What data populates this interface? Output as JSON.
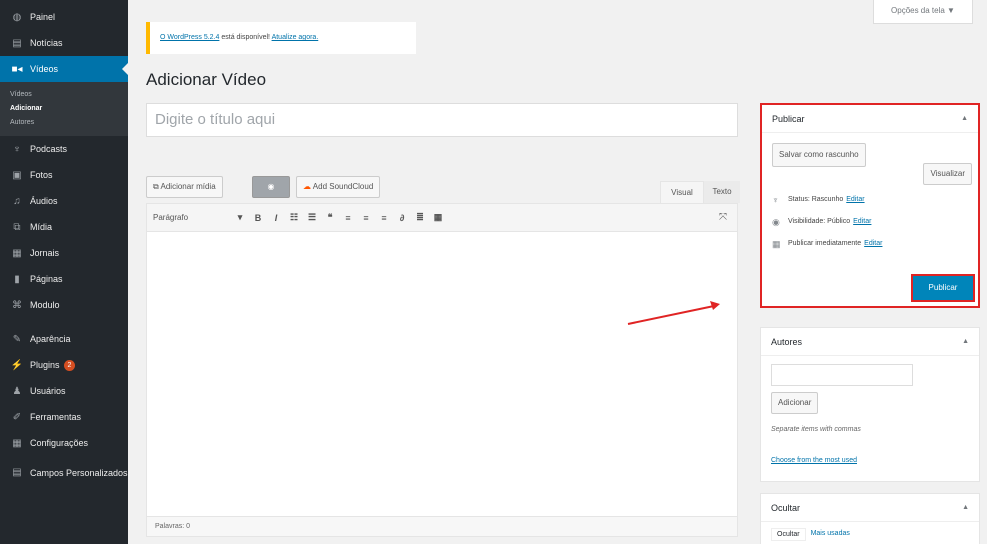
{
  "sidebar": {
    "items": [
      {
        "label": "Painel",
        "icon": "dashboard-icon",
        "glyph": "◍"
      },
      {
        "label": "Notícias",
        "icon": "posts-icon",
        "glyph": "▤"
      },
      {
        "label": "Vídeos",
        "icon": "video-icon",
        "glyph": "■◂",
        "active": true
      },
      {
        "label": "Podcasts",
        "icon": "microphone-icon",
        "glyph": "♆"
      },
      {
        "label": "Fotos",
        "icon": "image-icon",
        "glyph": "▣"
      },
      {
        "label": "Áudios",
        "icon": "music-icon",
        "glyph": "♫"
      },
      {
        "label": "Mídia",
        "icon": "media-icon",
        "glyph": "⧉"
      },
      {
        "label": "Jornais",
        "icon": "newspaper-icon",
        "glyph": "▦"
      },
      {
        "label": "Páginas",
        "icon": "pages-icon",
        "glyph": "▮"
      },
      {
        "label": "Modulo",
        "icon": "module-icon",
        "glyph": "⌘"
      },
      {
        "label": "Aparência",
        "icon": "appearance-icon",
        "glyph": "✎"
      },
      {
        "label": "Plugins",
        "icon": "plugins-icon",
        "glyph": "⚡",
        "badge": "2"
      },
      {
        "label": "Usuários",
        "icon": "users-icon",
        "glyph": "♟"
      },
      {
        "label": "Ferramentas",
        "icon": "tools-icon",
        "glyph": "✐"
      },
      {
        "label": "Configurações",
        "icon": "settings-icon",
        "glyph": "▦"
      },
      {
        "label": "Campos Personalizados",
        "icon": "custom-fields-icon",
        "glyph": "▤"
      }
    ],
    "submenu": [
      "Vídeos",
      "Adicionar",
      "Autores"
    ]
  },
  "screen_options": "Opções da tela ▼",
  "notice": {
    "link_version": "O WordPress 5.2.4",
    "text": " está disponível! ",
    "link_update": "Atualize agora."
  },
  "page_title": "Adicionar Vídeo",
  "title_placeholder": "Digite o título aqui",
  "media_buttons": {
    "add_media": "Adicionar mídia",
    "soundcloud": "Add SoundCloud"
  },
  "editor_tabs": {
    "visual": "Visual",
    "text": "Texto"
  },
  "toolbar": {
    "format": "Parágrafo",
    "buttons": [
      "▾",
      "B",
      "I",
      "☷",
      "☰",
      "❝",
      "≡",
      "≡",
      "≡",
      "∂",
      "≣",
      "▦"
    ],
    "expand": "⤧"
  },
  "editor_footer": "Palavras: 0",
  "publish": {
    "title": "Publicar",
    "save_draft": "Salvar como rascunho",
    "preview": "Visualizar",
    "status_label": "Status: Rascunho",
    "visibility_label": "Visibilidade: Público",
    "schedule_label": "Publicar imediatamente",
    "edit": "Editar",
    "publish_button": "Publicar"
  },
  "authors": {
    "title": "Autores",
    "add_button": "Adicionar",
    "hint": "Separate items with commas",
    "choose_link": "Choose from the most used"
  },
  "hide": {
    "title": "Ocultar",
    "tabs": [
      "Ocultar",
      "Mais usadas"
    ]
  },
  "colors": {
    "accent": "#0073aa",
    "sidebar": "#23282d",
    "highlight": "#e02424",
    "notice": "#ffb900"
  }
}
